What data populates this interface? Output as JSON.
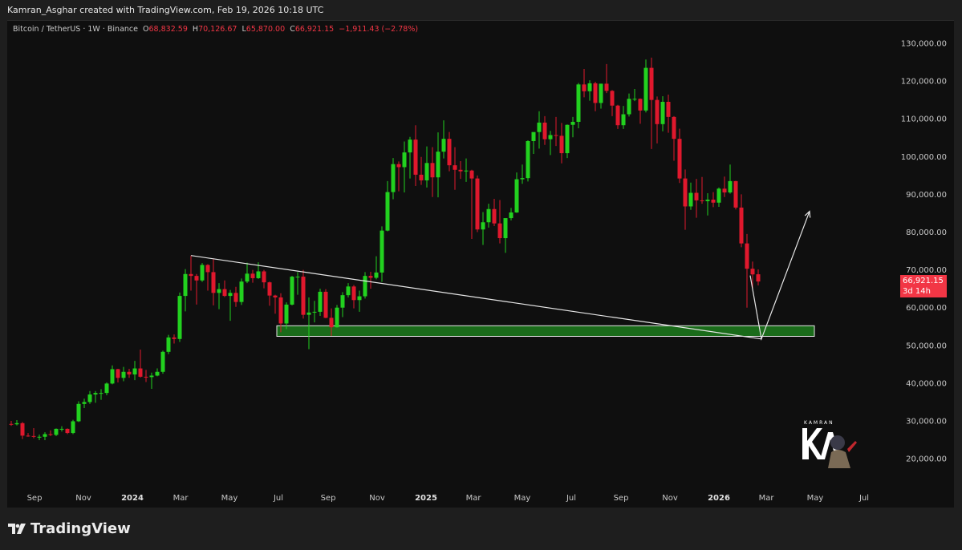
{
  "caption": "Kamran_Asghar created with TradingView.com, Feb 19, 2026 10:18 UTC",
  "legend": {
    "symbol": "Bitcoin / TetherUS · 1W · Binance",
    "o_label": "O",
    "o_value": "68,832.59",
    "h_label": "H",
    "h_value": "70,126.67",
    "l_label": "L",
    "l_value": "65,870.00",
    "c_label": "C",
    "c_value": "66,921.15",
    "change": "−1,911.43 (−2.78%)"
  },
  "price_tag": {
    "price": "66,921.15",
    "countdown": "3d 14h",
    "color": "#f23645"
  },
  "brand": {
    "name": "TradingView",
    "icon": "tradingview-logo-icon"
  },
  "watermark": {
    "text": "KAMRAN",
    "initials": "KA"
  },
  "chart_data": {
    "type": "candlestick",
    "title": "",
    "colors": {
      "up": "#22d11f",
      "down": "#e0182d",
      "background": "#0f0f0f"
    },
    "ylim": [
      20000,
      130000
    ],
    "y_ticks": [
      "130,000.00",
      "120,000.00",
      "110,000.00",
      "100,000.00",
      "90,000.00",
      "80,000.00",
      "70,000.00",
      "60,000.00",
      "50,000.00",
      "40,000.00",
      "30,000.00",
      "20,000.00"
    ],
    "y_tick_values": [
      130000,
      120000,
      110000,
      100000,
      90000,
      80000,
      70000,
      60000,
      50000,
      40000,
      30000,
      20000
    ],
    "x_ticks": [
      {
        "label": "Sep",
        "date": "2023-09-01"
      },
      {
        "label": "Nov",
        "date": "2023-11-01"
      },
      {
        "label": "2024",
        "date": "2024-01-01",
        "year": true
      },
      {
        "label": "Mar",
        "date": "2024-03-01"
      },
      {
        "label": "May",
        "date": "2024-05-01"
      },
      {
        "label": "Jul",
        "date": "2024-07-01"
      },
      {
        "label": "Sep",
        "date": "2024-09-01"
      },
      {
        "label": "Nov",
        "date": "2024-11-01"
      },
      {
        "label": "2025",
        "date": "2025-01-01",
        "year": true
      },
      {
        "label": "Mar",
        "date": "2025-03-01"
      },
      {
        "label": "May",
        "date": "2025-05-01"
      },
      {
        "label": "Jul",
        "date": "2025-07-01"
      },
      {
        "label": "Sep",
        "date": "2025-09-01"
      },
      {
        "label": "Nov",
        "date": "2025-11-01"
      },
      {
        "label": "2026",
        "date": "2026-01-01",
        "year": true
      },
      {
        "label": "Mar",
        "date": "2026-03-01"
      },
      {
        "label": "May",
        "date": "2026-05-01"
      },
      {
        "label": "Jul",
        "date": "2026-07-01"
      }
    ],
    "candle_fields": [
      "date",
      "open",
      "high",
      "low",
      "close"
    ],
    "candles": [
      [
        "2023-07-31",
        29200,
        30000,
        28700,
        29100
      ],
      [
        "2023-08-07",
        29100,
        30200,
        28800,
        29400
      ],
      [
        "2023-08-14",
        29400,
        29700,
        25200,
        26100
      ],
      [
        "2023-08-21",
        26100,
        26800,
        25800,
        26000
      ],
      [
        "2023-08-28",
        26000,
        28100,
        25400,
        25800
      ],
      [
        "2023-09-04",
        25800,
        26400,
        24900,
        25800
      ],
      [
        "2023-09-11",
        25800,
        27000,
        24900,
        26500
      ],
      [
        "2023-09-18",
        26500,
        27500,
        26000,
        26300
      ],
      [
        "2023-09-25",
        26300,
        28000,
        26000,
        27900
      ],
      [
        "2023-10-02",
        27900,
        28600,
        27200,
        27900
      ],
      [
        "2023-10-09",
        27900,
        28000,
        26500,
        26800
      ],
      [
        "2023-10-16",
        26800,
        30300,
        26500,
        29900
      ],
      [
        "2023-10-23",
        29900,
        35200,
        29700,
        34500
      ],
      [
        "2023-10-30",
        34500,
        35900,
        33400,
        35000
      ],
      [
        "2023-11-06",
        35000,
        37900,
        34500,
        37000
      ],
      [
        "2023-11-13",
        37000,
        37900,
        34800,
        37400
      ],
      [
        "2023-11-20",
        37400,
        38400,
        35600,
        37400
      ],
      [
        "2023-11-27",
        37400,
        40200,
        36800,
        39900
      ],
      [
        "2023-12-04",
        39900,
        44700,
        39700,
        43700
      ],
      [
        "2023-12-11",
        43700,
        43800,
        40200,
        41400
      ],
      [
        "2023-12-18",
        41400,
        44300,
        40500,
        43000
      ],
      [
        "2023-12-25",
        43000,
        43800,
        41400,
        42300
      ],
      [
        "2024-01-01",
        42300,
        45900,
        40800,
        43900
      ],
      [
        "2024-01-08",
        43900,
        48900,
        41500,
        41700
      ],
      [
        "2024-01-15",
        41700,
        43500,
        40300,
        41600
      ],
      [
        "2024-01-22",
        41600,
        42800,
        38500,
        42000
      ],
      [
        "2024-01-29",
        42000,
        43900,
        41800,
        43000
      ],
      [
        "2024-02-05",
        43000,
        48600,
        42500,
        48300
      ],
      [
        "2024-02-12",
        48300,
        52800,
        47700,
        52100
      ],
      [
        "2024-02-19",
        52100,
        52900,
        50500,
        51700
      ],
      [
        "2024-02-26",
        51700,
        64000,
        50900,
        63100
      ],
      [
        "2024-03-04",
        63100,
        70200,
        59000,
        68900
      ],
      [
        "2024-03-11",
        68900,
        73800,
        64500,
        68400
      ],
      [
        "2024-03-18",
        68400,
        68900,
        60800,
        67200
      ],
      [
        "2024-03-25",
        67200,
        71800,
        66800,
        71300
      ],
      [
        "2024-04-01",
        71300,
        71500,
        64500,
        69400
      ],
      [
        "2024-04-08",
        69400,
        72800,
        60600,
        63900
      ],
      [
        "2024-04-15",
        63900,
        66500,
        59600,
        64900
      ],
      [
        "2024-04-22",
        64900,
        67200,
        62800,
        63100
      ],
      [
        "2024-04-29",
        63100,
        64700,
        56500,
        63900
      ],
      [
        "2024-05-06",
        63900,
        65500,
        60200,
        61500
      ],
      [
        "2024-05-13",
        61500,
        67700,
        60700,
        66900
      ],
      [
        "2024-05-20",
        66900,
        71900,
        66500,
        69000
      ],
      [
        "2024-05-27",
        69000,
        70000,
        66600,
        67800
      ],
      [
        "2024-06-03",
        67800,
        72000,
        67600,
        69600
      ],
      [
        "2024-06-10",
        69600,
        70000,
        65100,
        66700
      ],
      [
        "2024-06-17",
        66700,
        66900,
        60500,
        63200
      ],
      [
        "2024-06-24",
        63200,
        63400,
        58400,
        62700
      ],
      [
        "2024-07-01",
        62700,
        63800,
        53500,
        55800
      ],
      [
        "2024-07-08",
        55800,
        61400,
        54300,
        60800
      ],
      [
        "2024-07-15",
        60800,
        68400,
        60600,
        68200
      ],
      [
        "2024-07-22",
        68200,
        69400,
        63400,
        68200
      ],
      [
        "2024-07-29",
        68200,
        70000,
        57100,
        58100
      ],
      [
        "2024-08-05",
        58100,
        62700,
        49000,
        58700
      ],
      [
        "2024-08-12",
        58700,
        61800,
        56100,
        58900
      ],
      [
        "2024-08-19",
        58900,
        65000,
        57800,
        64200
      ],
      [
        "2024-08-26",
        64200,
        64900,
        57200,
        57300
      ],
      [
        "2024-09-02",
        57300,
        59800,
        52500,
        54800
      ],
      [
        "2024-09-09",
        54800,
        60700,
        54700,
        60000
      ],
      [
        "2024-09-16",
        60000,
        64100,
        57500,
        63300
      ],
      [
        "2024-09-23",
        63300,
        66500,
        62700,
        65600
      ],
      [
        "2024-09-30",
        65600,
        66000,
        59800,
        62000
      ],
      [
        "2024-10-07",
        62000,
        64500,
        58900,
        63000
      ],
      [
        "2024-10-14",
        63000,
        69400,
        62400,
        68400
      ],
      [
        "2024-10-21",
        68400,
        69500,
        65000,
        67900
      ],
      [
        "2024-10-28",
        67900,
        73600,
        67500,
        69300
      ],
      [
        "2024-11-04",
        69300,
        81500,
        66800,
        80400
      ],
      [
        "2024-11-11",
        80400,
        93500,
        80200,
        90600
      ],
      [
        "2024-11-18",
        90600,
        99600,
        88700,
        98000
      ],
      [
        "2024-11-25",
        98000,
        98700,
        90800,
        97200
      ],
      [
        "2024-12-02",
        97200,
        104000,
        90500,
        101100
      ],
      [
        "2024-12-09",
        101100,
        105200,
        94200,
        104500
      ],
      [
        "2024-12-16",
        104500,
        108300,
        92200,
        95200
      ],
      [
        "2024-12-23",
        95200,
        99900,
        92500,
        93700
      ],
      [
        "2024-12-30",
        93700,
        102700,
        91800,
        98300
      ],
      [
        "2025-01-06",
        98300,
        102500,
        89300,
        94500
      ],
      [
        "2025-01-13",
        94500,
        106400,
        89200,
        101300
      ],
      [
        "2025-01-20",
        101300,
        109600,
        99500,
        104700
      ],
      [
        "2025-01-27",
        104700,
        106500,
        96100,
        97700
      ],
      [
        "2025-02-03",
        97700,
        102500,
        91200,
        96500
      ],
      [
        "2025-02-10",
        96500,
        98800,
        94100,
        96100
      ],
      [
        "2025-02-17",
        96100,
        99500,
        93300,
        96300
      ],
      [
        "2025-02-24",
        96300,
        96500,
        78200,
        94200
      ],
      [
        "2025-03-03",
        94200,
        95000,
        80000,
        80700
      ],
      [
        "2025-03-10",
        80700,
        85300,
        76600,
        82600
      ],
      [
        "2025-03-17",
        82600,
        87500,
        81200,
        86100
      ],
      [
        "2025-03-24",
        86100,
        88800,
        81600,
        82300
      ],
      [
        "2025-03-31",
        82300,
        88500,
        77000,
        78400
      ],
      [
        "2025-04-07",
        78400,
        83600,
        74500,
        83700
      ],
      [
        "2025-04-14",
        83700,
        86400,
        83100,
        85200
      ],
      [
        "2025-04-21",
        85200,
        95800,
        85100,
        94000
      ],
      [
        "2025-04-28",
        94000,
        97900,
        92800,
        94300
      ],
      [
        "2025-05-05",
        94300,
        104300,
        93400,
        104100
      ],
      [
        "2025-05-12",
        104100,
        105800,
        100700,
        106500
      ],
      [
        "2025-05-19",
        106500,
        112000,
        102100,
        109000
      ],
      [
        "2025-05-26",
        109000,
        110700,
        103100,
        104600
      ],
      [
        "2025-06-02",
        104600,
        106800,
        100400,
        105700
      ],
      [
        "2025-06-09",
        105700,
        110500,
        102800,
        105500
      ],
      [
        "2025-06-16",
        105500,
        108900,
        98200,
        100900
      ],
      [
        "2025-06-23",
        100900,
        108500,
        99600,
        108400
      ],
      [
        "2025-06-30",
        108400,
        110500,
        105100,
        109200
      ],
      [
        "2025-07-07",
        109200,
        119500,
        107500,
        119100
      ],
      [
        "2025-07-14",
        119100,
        123200,
        115700,
        117300
      ],
      [
        "2025-07-21",
        117300,
        120200,
        114800,
        119400
      ],
      [
        "2025-07-28",
        119400,
        119800,
        112000,
        114200
      ],
      [
        "2025-08-04",
        114200,
        119300,
        112700,
        119300
      ],
      [
        "2025-08-11",
        119300,
        124500,
        116800,
        117400
      ],
      [
        "2025-08-18",
        117400,
        117600,
        110700,
        113500
      ],
      [
        "2025-08-25",
        113500,
        113700,
        107300,
        108300
      ],
      [
        "2025-09-01",
        108300,
        113400,
        107300,
        111200
      ],
      [
        "2025-09-08",
        111200,
        116700,
        110600,
        115300
      ],
      [
        "2025-09-15",
        115300,
        117900,
        114700,
        115300
      ],
      [
        "2025-09-22",
        115300,
        115400,
        108700,
        112200
      ],
      [
        "2025-09-29",
        112200,
        125700,
        111700,
        123500
      ],
      [
        "2025-10-06",
        123500,
        126200,
        102000,
        115000
      ],
      [
        "2025-10-13",
        115000,
        115900,
        103500,
        108600
      ],
      [
        "2025-10-20",
        108600,
        116000,
        106700,
        114500
      ],
      [
        "2025-10-27",
        114500,
        116400,
        106300,
        110500
      ],
      [
        "2025-11-03",
        110500,
        110700,
        98900,
        104700
      ],
      [
        "2025-11-10",
        104700,
        107400,
        93000,
        94200
      ],
      [
        "2025-11-17",
        94200,
        96600,
        80600,
        86800
      ],
      [
        "2025-11-24",
        86800,
        93100,
        85900,
        90400
      ],
      [
        "2025-12-01",
        90400,
        94100,
        83800,
        88400
      ],
      [
        "2025-12-08",
        88400,
        94600,
        87500,
        88200
      ],
      [
        "2025-12-15",
        88200,
        90300,
        84400,
        88600
      ],
      [
        "2025-12-22",
        88600,
        90600,
        86600,
        87800
      ],
      [
        "2025-12-29",
        87800,
        91800,
        86700,
        91500
      ],
      [
        "2026-01-05",
        91500,
        94700,
        89300,
        90500
      ],
      [
        "2026-01-12",
        90500,
        97900,
        90200,
        93500
      ],
      [
        "2026-01-19",
        93500,
        93600,
        86000,
        86500
      ],
      [
        "2026-01-26",
        86500,
        90000,
        76000,
        77000
      ],
      [
        "2026-02-02",
        77000,
        79500,
        60000,
        70300
      ],
      [
        "2026-02-09",
        70300,
        72200,
        65000,
        68800
      ],
      [
        "2026-02-16",
        68832.59,
        70126.67,
        65870,
        66921.15
      ]
    ],
    "annotations": {
      "trendline": {
        "from": [
          "2024-03-11",
          73800
        ],
        "to": [
          "2026-02-23",
          51700
        ],
        "color": "#e6e6e6"
      },
      "support_zone": {
        "from_date": "2024-07-01",
        "to_date": "2026-05-01",
        "low": 52400,
        "high": 55200,
        "fill": "#1a6b1a",
        "border": "#e6e6e6"
      },
      "projection_path": {
        "points": [
          [
            "2026-02-09",
            68500
          ],
          [
            "2026-02-23",
            51700
          ],
          [
            "2026-04-24",
            85500
          ]
        ],
        "color": "#e6e6e6",
        "arrow": true
      }
    }
  }
}
